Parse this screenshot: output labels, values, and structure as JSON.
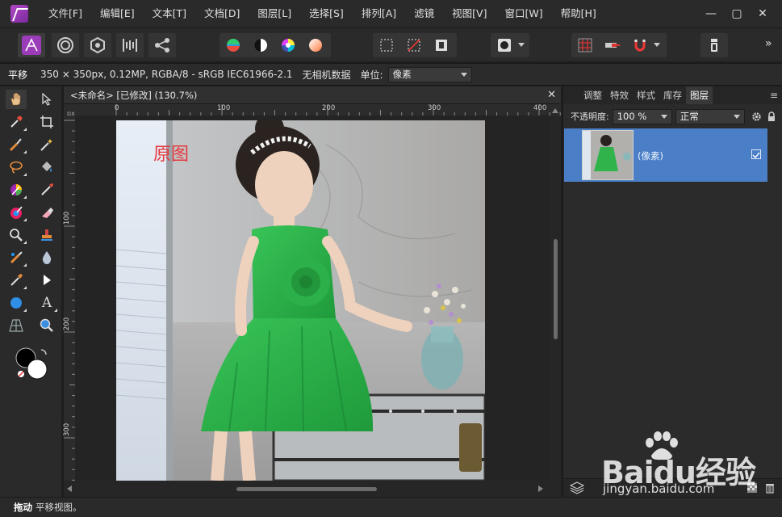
{
  "app": {
    "name": "Affinity Photo"
  },
  "menu": {
    "items": [
      "文件[F]",
      "编辑[E]",
      "文本[T]",
      "文档[D]",
      "图层[L]",
      "选择[S]",
      "排列[A]",
      "滤镜",
      "视图[V]",
      "窗口[W]",
      "帮助[H]"
    ]
  },
  "window_controls": {
    "minimize": "—",
    "maximize": "▢",
    "close": "✕"
  },
  "toolbar": {
    "overflow": "»"
  },
  "context": {
    "tool_name": "平移",
    "doc_info": "350 × 350px, 0.12MP, RGBA/8 - sRGB IEC61966-2.1",
    "camera_data": "无相机数据",
    "unit_label": "单位:",
    "unit_value": "像素"
  },
  "document": {
    "tab_title": "<未命名> [已修改] (130.7%)",
    "close": "✕",
    "ruler_unit": "px",
    "ruler_h_ticks": [
      "0",
      "100",
      "200",
      "300",
      "400"
    ],
    "ruler_v_ticks": [
      "100",
      "200",
      "300"
    ],
    "image_title": "原图"
  },
  "panel": {
    "tabs": [
      "调整",
      "特效",
      "样式",
      "库存",
      "图层"
    ],
    "active_tab": "图层",
    "menu": "≡",
    "opacity_label": "不透明度:",
    "opacity_value": "100 %",
    "blend_mode": "正常",
    "layers": [
      {
        "name": "(像素)",
        "visible": true
      }
    ]
  },
  "status": {
    "tool": "拖动",
    "hint": "平移视图。"
  },
  "watermark": {
    "brand": "Baidu经验",
    "url": "jingyan.baidu.com"
  },
  "colors": {
    "accent": "#4a7fc8",
    "brand": "#9b3db8",
    "title_red": "#e6373c",
    "dress_green": "#2fb34a"
  }
}
